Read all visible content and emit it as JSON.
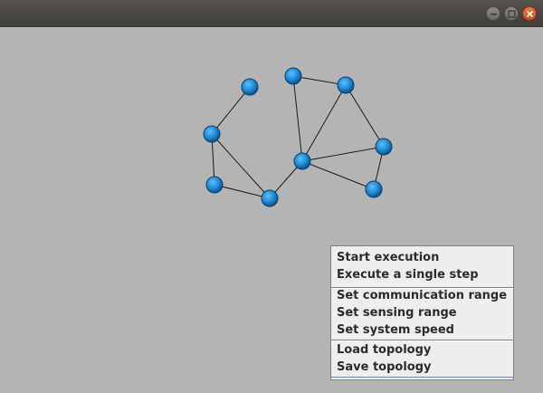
{
  "menu": {
    "groups": [
      [
        "Start execution",
        "Execute a single step"
      ],
      [
        "Set communication range",
        "Set sensing range",
        "Set system speed"
      ],
      [
        "Load topology",
        "Save topology"
      ]
    ]
  },
  "colors": {
    "background": "#b4b4b4",
    "node": "#1e88d0",
    "edge": "#1a1a1a",
    "titlebar": "#4a4844",
    "close": "#e05a24"
  },
  "icons": [
    "minimize-icon",
    "maximize-icon",
    "close-icon"
  ]
}
